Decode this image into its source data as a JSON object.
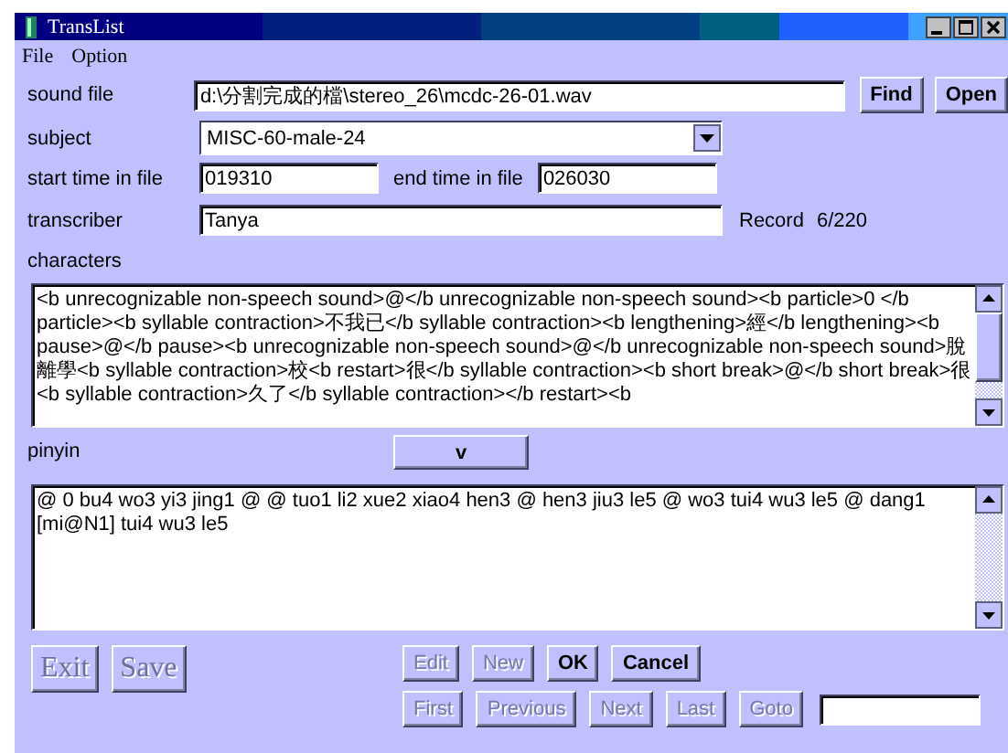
{
  "window": {
    "title": "TransList"
  },
  "menu": [
    "File",
    "Option"
  ],
  "sound_file": {
    "label": "sound file",
    "value": "d:\\分割完成的檔\\stereo_26\\mcdc-26-01.wav",
    "buttons": [
      {
        "label": "Find",
        "disabled": false
      },
      {
        "label": "Open",
        "disabled": false
      }
    ]
  },
  "subject": {
    "label": "subject",
    "value": "MISC-60-male-24"
  },
  "start_time": {
    "label": "start time in file",
    "value": "019310"
  },
  "end_time": {
    "label": "end time in file",
    "value": "026030"
  },
  "transcriber": {
    "label": "transcriber",
    "value": "Tanya"
  },
  "record": {
    "label": "Record",
    "value": "6/220"
  },
  "characters": {
    "label": "characters",
    "text": "<b unrecognizable non-speech sound>@</b unrecognizable non-speech sound><b particle>0 </b particle><b syllable contraction>不我已</b syllable contraction><b lengthening>經</b lengthening><b pause>@</b pause><b unrecognizable non-speech sound>@</b unrecognizable non-speech sound>脫離學<b syllable contraction>校<b restart>很</b syllable contraction><b short break>@</b short break>很<b syllable contraction>久了</b syllable contraction></b restart><b"
  },
  "pinyin": {
    "label": "pinyin",
    "button": "v",
    "text": "@ 0 bu4 wo3 yi3 jing1 @ @ tuo1 li2 xue2 xiao4 hen3 @ hen3 jiu3 le5 @ wo3 tui4 wu3 le5 @ dang1 [mi@N1] tui4 wu3 le5"
  },
  "left_buttons": [
    {
      "label": "Exit",
      "disabled": true
    },
    {
      "label": "Save",
      "disabled": true
    }
  ],
  "edit_buttons": [
    {
      "label": "Edit",
      "disabled": true
    },
    {
      "label": "New",
      "disabled": true
    },
    {
      "label": "OK",
      "disabled": false
    },
    {
      "label": "Cancel",
      "disabled": false
    }
  ],
  "nav_buttons": [
    {
      "label": "First",
      "disabled": true
    },
    {
      "label": "Previous",
      "disabled": true
    },
    {
      "label": "Next",
      "disabled": true
    },
    {
      "label": "Last",
      "disabled": true
    },
    {
      "label": "Goto",
      "disabled": true
    }
  ]
}
